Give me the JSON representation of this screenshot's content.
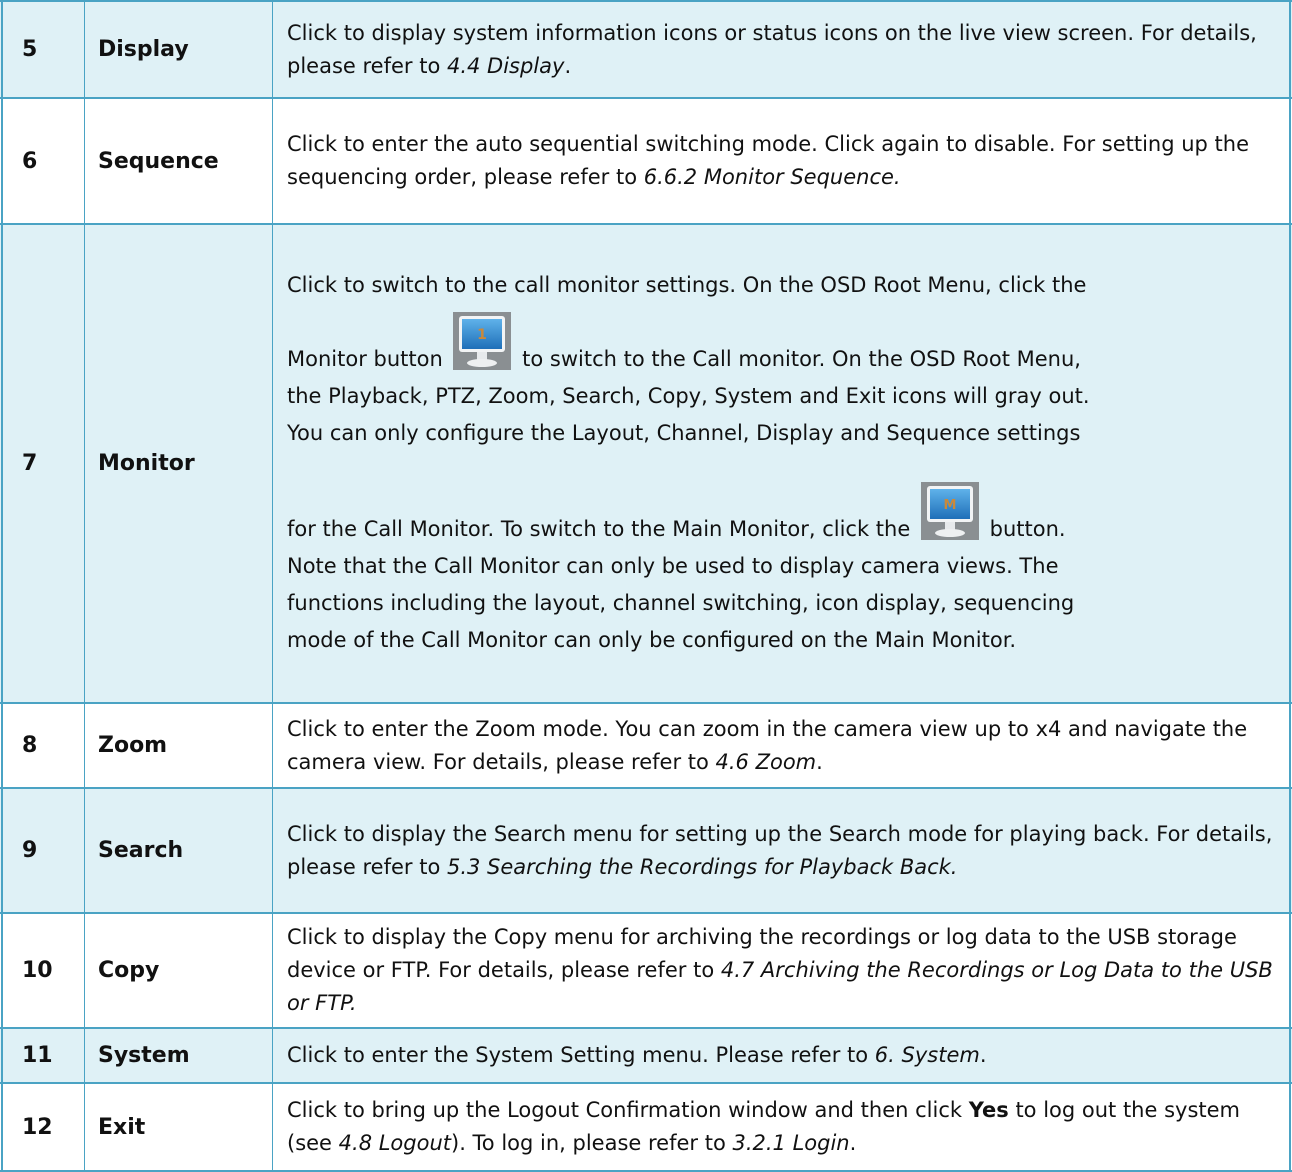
{
  "rows": [
    {
      "num": "5",
      "name": "Display",
      "d1": "Click to display system information icons or status icons on the live view screen. For details, please refer to ",
      "ref": "4.4 Display",
      "d2": "."
    },
    {
      "num": "6",
      "name": "Sequence",
      "d1": "Click to enter the auto sequential switching mode. Click again to disable. For setting up the sequencing order, please refer to ",
      "ref": "6.6.2 Monitor Sequence.",
      "d2": ""
    },
    {
      "num": "7",
      "name": "Monitor",
      "l1": "Click to switch to the call monitor settings. On the OSD Root Menu, click the",
      "l2a": "Monitor button",
      "l2b": "to switch to the Call monitor. On the OSD Root Menu,",
      "l3": "the Playback, PTZ, Zoom, Search, Copy, System and Exit icons will gray out.",
      "l4": "You can only configure the Layout, Channel, Display and Sequence settings",
      "l5a": "for the Call Monitor. To switch to the Main Monitor, click the",
      "l5b": "button.",
      "l6": "Note that the Call Monitor can only be used to display camera views. The",
      "l7": "functions including the layout, channel switching, icon display, sequencing",
      "l8": "mode of the Call Monitor can only be configured on the Main Monitor.",
      "icon1_label": "1",
      "icon2_label": "M"
    },
    {
      "num": "8",
      "name": "Zoom",
      "d1": "Click to enter the Zoom mode. You can zoom in the camera view up to x4 and navigate the camera view. For details, please refer to ",
      "ref": "4.6 Zoom",
      "d2": "."
    },
    {
      "num": "9",
      "name": "Search",
      "d1": "Click to display the Search menu for setting up the Search mode for playing back. For details, please refer to ",
      "ref": "5.3 Searching the Recordings for Playback Back.",
      "d2": ""
    },
    {
      "num": "10",
      "name": "Copy",
      "d1": "Click to display the Copy menu for archiving the recordings or log data to the USB storage device or FTP. For details, please refer to ",
      "ref": "4.7 Archiving the Recordings or Log Data to the USB or FTP.",
      "d2": ""
    },
    {
      "num": "11",
      "name": "System",
      "d1": "Click to enter the System Setting menu. Please refer to ",
      "ref": "6. System",
      "d2": "."
    },
    {
      "num": "12",
      "name": "Exit",
      "d1": "Click to bring up the Logout Confirmation window and then click ",
      "yes": "Yes",
      "d1b": " to log out the system (see ",
      "ref": "4.8 Logout",
      "d2": "). To log in, please refer to ",
      "ref2": "3.2.1 Login",
      "d3": "."
    }
  ],
  "colors": {
    "border": "#4aa3c4",
    "shade": "#dff1f6"
  }
}
